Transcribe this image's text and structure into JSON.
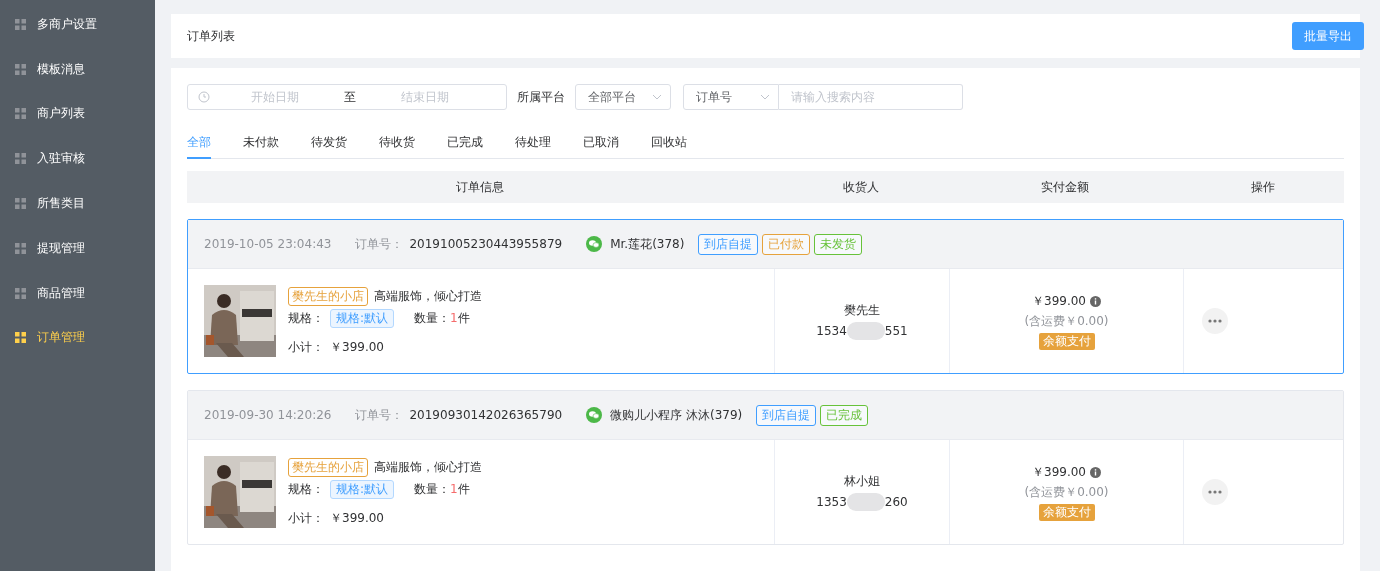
{
  "sidebar": {
    "items": [
      {
        "label": "多商户设置",
        "selected": false
      },
      {
        "label": "模板消息",
        "selected": false
      },
      {
        "label": "商户列表",
        "selected": false
      },
      {
        "label": "入驻审核",
        "selected": false
      },
      {
        "label": "所售类目",
        "selected": false
      },
      {
        "label": "提现管理",
        "selected": false
      },
      {
        "label": "商品管理",
        "selected": false
      },
      {
        "label": "订单管理",
        "selected": true
      }
    ]
  },
  "header": {
    "title": "订单列表",
    "export_button": "批量导出"
  },
  "filters": {
    "start_placeholder": "开始日期",
    "range_separator": "至",
    "end_placeholder": "结束日期",
    "platform_label": "所属平台",
    "platform_value": "全部平台",
    "search_type": "订单号",
    "search_placeholder": "请输入搜索内容"
  },
  "tabs": [
    {
      "label": "全部",
      "selected": true
    },
    {
      "label": "未付款",
      "selected": false
    },
    {
      "label": "待发货",
      "selected": false
    },
    {
      "label": "待收货",
      "selected": false
    },
    {
      "label": "已完成",
      "selected": false
    },
    {
      "label": "待处理",
      "selected": false
    },
    {
      "label": "已取消",
      "selected": false
    },
    {
      "label": "回收站",
      "selected": false
    }
  ],
  "table": {
    "columns": [
      "订单信息",
      "收货人",
      "实付金额",
      "操作"
    ]
  },
  "orders": [
    {
      "selected": true,
      "time": "2019-10-05 23:04:43",
      "order_label": "订单号：",
      "order_no": "20191005230443955879",
      "buyer": "Mr.莲花(378)",
      "tags": [
        {
          "label": "到店自提",
          "color": "#409eff"
        },
        {
          "label": "已付款",
          "color": "#e6a23c"
        },
        {
          "label": "未发货",
          "color": "#67c23a"
        }
      ],
      "shop": "樊先生的小店",
      "product": "高端服饰，倾心打造",
      "spec_label": "规格：",
      "spec": "规格:默认",
      "qty_label": "数量：",
      "qty": "1",
      "qty_unit": "件",
      "subtotal_label": "小计：",
      "subtotal": "￥399.00",
      "receiver": "樊先生",
      "phone_start": "1534",
      "phone_end": "551",
      "amount": "￥399.00",
      "shipping": "(含运费￥0.00)",
      "payment": "余额支付"
    },
    {
      "selected": false,
      "time": "2019-09-30 14:20:26",
      "order_label": "订单号：",
      "order_no": "20190930142026365790",
      "buyer": "微购儿小程序 沐沐(379)",
      "tags": [
        {
          "label": "到店自提",
          "color": "#409eff"
        },
        {
          "label": "已完成",
          "color": "#67c23a"
        }
      ],
      "shop": "樊先生的小店",
      "product": "高端服饰，倾心打造",
      "spec_label": "规格：",
      "spec": "规格:默认",
      "qty_label": "数量：",
      "qty": "1",
      "qty_unit": "件",
      "subtotal_label": "小计：",
      "subtotal": "￥399.00",
      "receiver": "林小姐",
      "phone_start": "1353",
      "phone_end": "260",
      "amount": "￥399.00",
      "shipping": "(含运费￥0.00)",
      "payment": "余额支付"
    }
  ]
}
